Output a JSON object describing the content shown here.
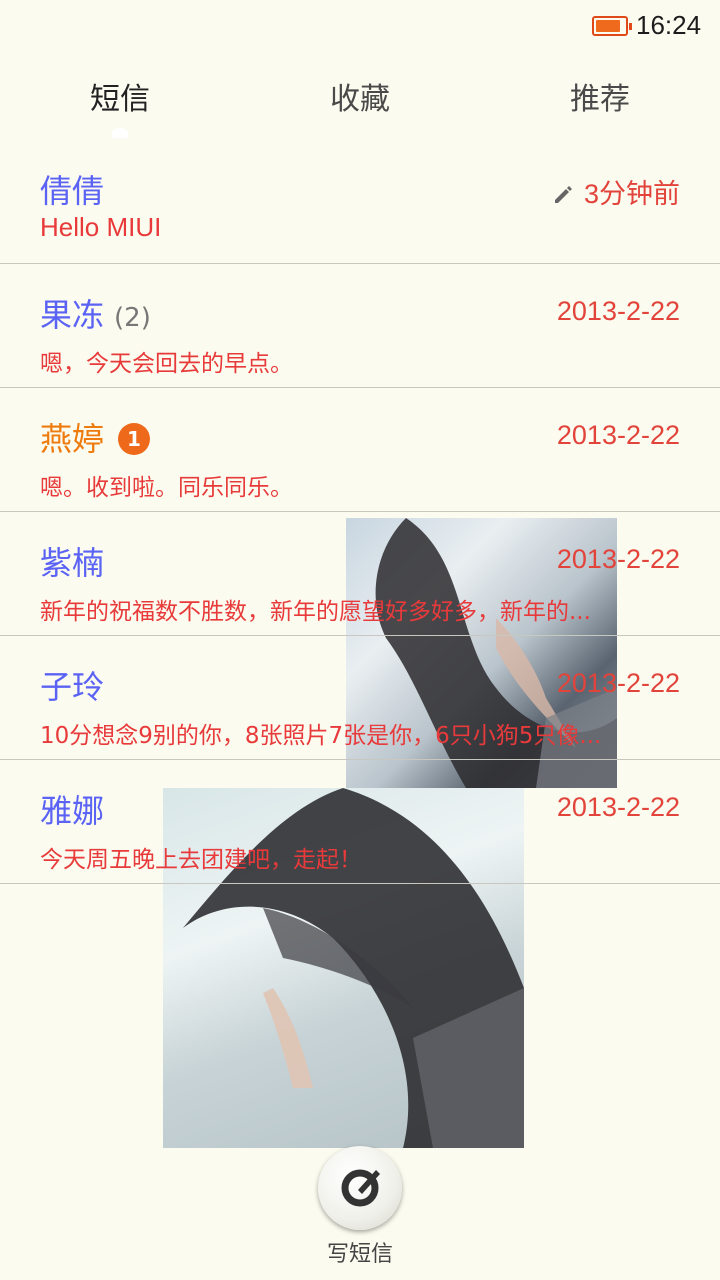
{
  "status_bar": {
    "time": "16:24",
    "battery_level": 0.85
  },
  "tabs": [
    {
      "label": "短信",
      "active": true
    },
    {
      "label": "收藏",
      "active": false
    },
    {
      "label": "推荐",
      "active": false
    }
  ],
  "conversations": [
    {
      "name": "倩倩",
      "count": "",
      "unread": "",
      "date": "3分钟前",
      "draft": true,
      "preview": "Hello MIUI"
    },
    {
      "name": "果冻",
      "count": "(2)",
      "unread": "",
      "date": "2013-2-22",
      "draft": false,
      "preview": "嗯，今天会回去的早点。"
    },
    {
      "name": "燕婷",
      "count": "",
      "unread": "1",
      "date": "2013-2-22",
      "draft": false,
      "preview": "嗯。收到啦。同乐同乐。"
    },
    {
      "name": "紫楠",
      "count": "",
      "unread": "",
      "date": "2013-2-22",
      "draft": false,
      "preview": "新年的祝福数不胜数，新年的愿望好多好多，新年的..."
    },
    {
      "name": "子玲",
      "count": "",
      "unread": "",
      "date": "2013-2-22",
      "draft": false,
      "preview": "10分想念9别的你，8张照片7张是你，6只小狗5只像..."
    },
    {
      "name": "雅娜",
      "count": "",
      "unread": "",
      "date": "2013-2-22",
      "draft": false,
      "preview": "今天周五晚上去团建吧，走起！"
    }
  ],
  "compose": {
    "label": "写短信",
    "icon": "compose-icon"
  },
  "colors": {
    "name": "#5b63f5",
    "name_unread": "#ee7b0e",
    "date": "#e2443c",
    "preview": "#e83a3a",
    "badge": "#ee6a1a",
    "background": "#fbfbef"
  }
}
